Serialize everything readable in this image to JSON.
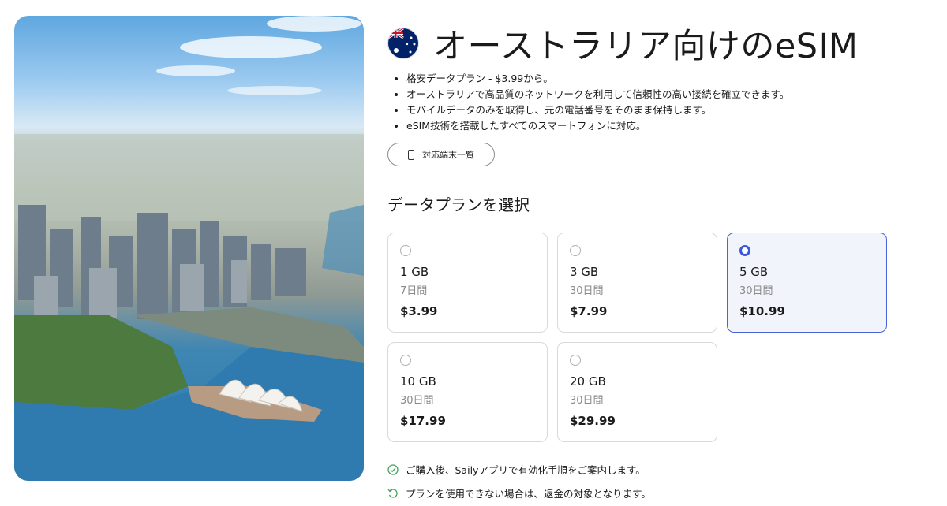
{
  "hero": {
    "image": "sydney-opera-house-aerial"
  },
  "header": {
    "flag_icon": "australia-flag-icon",
    "title": "オーストラリア向けのeSIM"
  },
  "features": [
    "格安データプラン - $3.99から。",
    "オーストラリアで高品質のネットワークを利用して信頼性の高い接続を確立できます。",
    "モバイルデータのみを取得し、元の電話番号をそのまま保持します。",
    "eSIM技術を搭載したすべてのスマートフォンに対応。"
  ],
  "compat_button": {
    "label": "対応端末一覧",
    "icon": "phone-icon"
  },
  "plans_section": {
    "title": "データプランを選択"
  },
  "plans": [
    {
      "gb": "1 GB",
      "days": "7日間",
      "price": "$3.99",
      "selected": false
    },
    {
      "gb": "3 GB",
      "days": "30日間",
      "price": "$7.99",
      "selected": false
    },
    {
      "gb": "5 GB",
      "days": "30日間",
      "price": "$10.99",
      "selected": true
    },
    {
      "gb": "10 GB",
      "days": "30日間",
      "price": "$17.99",
      "selected": false
    },
    {
      "gb": "20 GB",
      "days": "30日間",
      "price": "$29.99",
      "selected": false
    }
  ],
  "notes": [
    {
      "icon": "check-circle-icon",
      "text": "ご購入後、Sailyアプリで有効化手順をご案内します。",
      "color": "#3ea35a"
    },
    {
      "icon": "refund-arrow-icon",
      "text": "プランを使用できない場合は、返金の対象となります。",
      "color": "#3ea35a"
    }
  ],
  "colors": {
    "accent": "#3b57e0",
    "selected_bg": "#f1f4fb",
    "muted": "#8a8a8a"
  }
}
